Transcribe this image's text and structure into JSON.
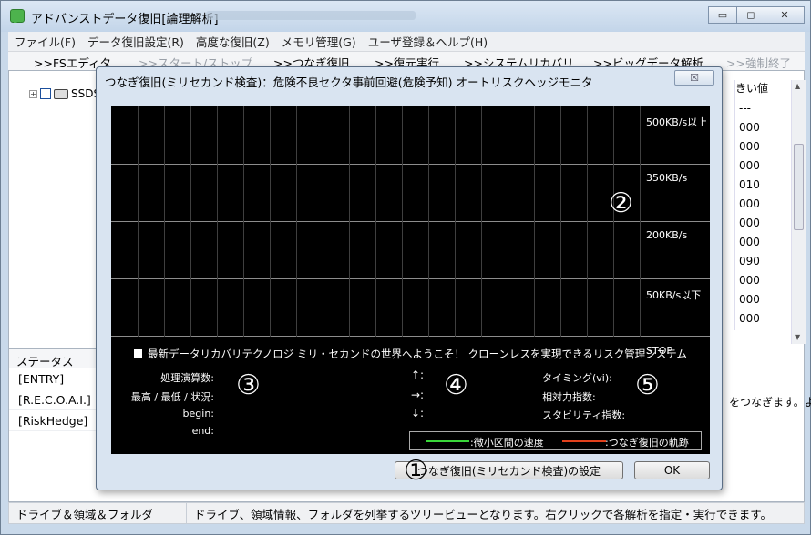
{
  "window": {
    "title": "アドバンストデータ復旧[論理解析]",
    "minimize_glyph": "▭",
    "maximize_glyph": "◻",
    "close_glyph": "✕"
  },
  "menu": [
    "ファイル(F)",
    "データ復旧設定(R)",
    "高度な復旧(Z)",
    "メモリ管理(G)",
    "ユーザ登録＆ヘルプ(H)"
  ],
  "toolbar": {
    "fs_editor": ">>FSエディタ",
    "start_stop": ">>スタート/ストップ",
    "tsunagi": ">>つなぎ復旧",
    "restore": ">>復元実行",
    "system_recovery": ">>システムリカバリ",
    "bigdata": ">>ビッグデータ解析",
    "force_end": ">>強制終了"
  },
  "tree": {
    "drive_label": "SSDS"
  },
  "right_column": {
    "header": "きい値",
    "values": [
      "---",
      "000",
      "000",
      "000",
      "010",
      "000",
      "000",
      "000",
      "090",
      "000",
      "000",
      "000"
    ]
  },
  "status_pane": {
    "header": "ステータス",
    "lines": [
      "[ENTRY]",
      "[R.E.C.O.A.I.]",
      "[RiskHedge]"
    ]
  },
  "right_text": "をつなぎます。よ",
  "bottom": {
    "left": "ドライブ＆領域＆フォルダ",
    "right": "ドライブ、領域情報、フォルダを列挙するツリービューとなります。右クリックで各解析を指定・実行できます。"
  },
  "dialog": {
    "title": "つなぎ復旧(ミリセカンド検査)：危険不良セクタ事前回避(危険予知) オートリスクヘッジモニタ",
    "close_glyph": "☒",
    "scale": [
      "500KB/s以上",
      "350KB/s",
      "200KB/s",
      "50KB/s以下"
    ],
    "stop": "STOP",
    "welcome": "最新データリカバリテクノロジ ミリ・セカンドの世界へようこそ！ クローンレスを実現できるリスク管理システム",
    "left_labels": [
      "処理演算数:",
      "最高 / 最低 / 状況:",
      "begin:",
      "end:"
    ],
    "arrows": [
      "↑:",
      "→:",
      "↓:"
    ],
    "right_labels": [
      "タイミング(vi):",
      "相対力指数:",
      "スタビリティ指数:"
    ],
    "markers": [
      "①",
      "②",
      "③",
      "④",
      "⑤"
    ],
    "legend": {
      "green": ":微小区間の速度",
      "red": ":つなぎ復旧の軌跡",
      "green_color": "#39d639",
      "red_color": "#e2401c"
    },
    "settings_button": "つなぎ復旧(ミリセカンド検査)の設定",
    "ok_button": "OK"
  }
}
